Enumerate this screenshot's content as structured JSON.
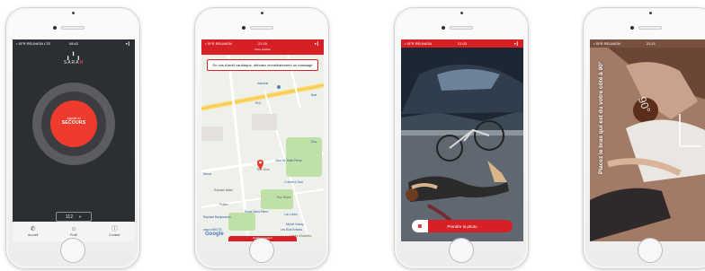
{
  "phones": {
    "p1": {
      "status": {
        "carrier": "• SFR REUNION  LTE",
        "time": "08:42",
        "battery": "▾ ▎"
      },
      "logo": {
        "text_a": "SARA",
        "text_b": "H"
      },
      "sos": {
        "small": "Appuie ici",
        "big": "SECOURS"
      },
      "select": {
        "value": "112"
      },
      "tabs": [
        {
          "label": "Accueil",
          "icon": "phone-icon"
        },
        {
          "label": "Profil",
          "icon": "user-icon"
        },
        {
          "label": "Contact",
          "icon": "info-icon"
        }
      ]
    },
    "p2": {
      "status": {
        "carrier": "• SFR REUNION",
        "time": "21:20",
        "battery": "▾ ▎"
      },
      "subtitle": "Votre position",
      "alert": "En cas d'arrêt cardiaque, débutez immédiatement un massage",
      "map_labels": {
        "industrie": "Industrie",
        "rn1": "RN1",
        "gare": "Gare De Saint Pierre",
        "sua": "Sua",
        "lusine": "L'Usine à Gour",
        "baie": "Baie",
        "neuve": "Neuve",
        "rue_gros": "Rue Gros",
        "raphael": "Raphael Babet",
        "roche": "Rue Roche",
        "petites": "Petites",
        "lycee": "Lycée Lavergne",
        "route": "Route Saint-Pierre",
        "raphael_barq": "Raphael Barquisseau",
        "luc": "Luc Lorion",
        "voinay": "Michel Voinay",
        "enfants": "Les Bois Enfants",
        "amiutis": "amos AMIUTS",
        "loisirs": "Loisirs d'Activites"
      },
      "google": "Google",
      "bottom_button": "Appeler les secours"
    },
    "p3": {
      "status": {
        "carrier": "• SFR REUNION",
        "time": "21:03",
        "battery": "▾ ▎"
      },
      "button": "Prendre la photo"
    },
    "p4": {
      "status": {
        "carrier": "• SFR REUNION",
        "time": "21:21",
        "battery": ""
      },
      "instruction": "Placez le bras qui est du votre côté à 90°",
      "angle_label": "90°"
    }
  },
  "colors": {
    "brand_red": "#d71f26",
    "sos_red": "#ee3b2d",
    "dark_bg": "#2b2e33"
  }
}
